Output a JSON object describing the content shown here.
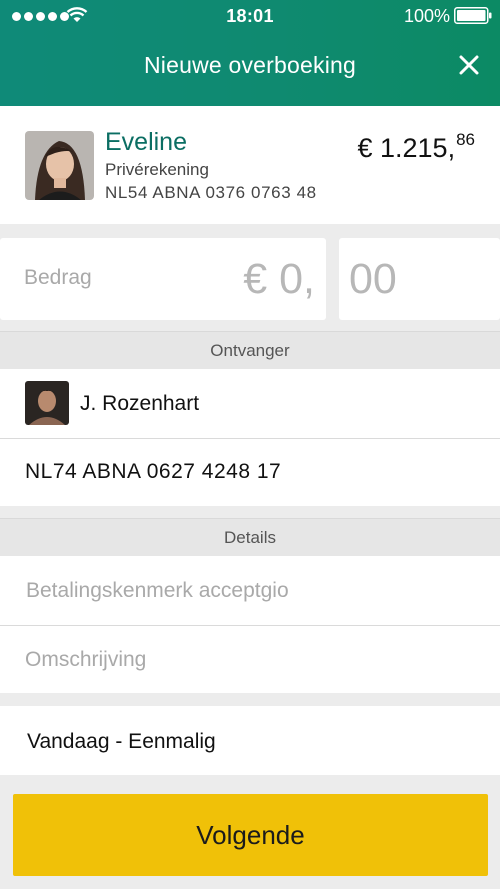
{
  "status_bar": {
    "time": "18:01",
    "battery_percent": "100%"
  },
  "header": {
    "title": "Nieuwe overboeking",
    "close_icon": "close-icon"
  },
  "account": {
    "name": "Eveline",
    "type": "Privérekening",
    "iban": "NL54 ABNA 0376 0763 48",
    "balance_main": "€ 1.215,",
    "balance_cents": "86"
  },
  "amount": {
    "label": "Bedrag",
    "euro": "€ 0,",
    "cents": "00"
  },
  "recipient": {
    "section_title": "Ontvanger",
    "name": "J. Rozenhart",
    "iban": "NL74 ABNA 0627 4248 17"
  },
  "details": {
    "section_title": "Details",
    "reference_placeholder": "Betalingskenmerk acceptgio",
    "description_placeholder": "Omschrijving"
  },
  "schedule": {
    "value": "Vandaag - Eenmalig"
  },
  "next_button": {
    "label": "Volgende"
  },
  "colors": {
    "header": "#0f8a70",
    "accent": "#0b6e63",
    "button": "#f0c108"
  }
}
